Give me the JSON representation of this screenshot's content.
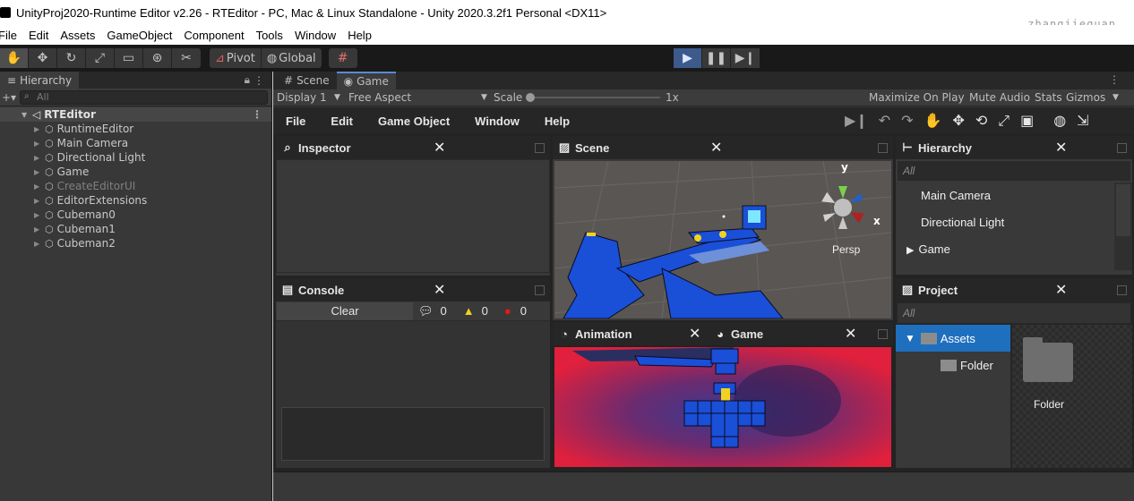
{
  "window": {
    "title": "UnityProj2020-Runtime Editor v2.26 - RTEditor - PC, Mac & Linux Standalone - Unity 2020.3.2f1 Personal <DX11>",
    "watermark": "zhangjiequan"
  },
  "menubar": [
    "File",
    "Edit",
    "Assets",
    "GameObject",
    "Component",
    "Tools",
    "Window",
    "Help"
  ],
  "toolbar": {
    "pivot": "Pivot",
    "global": "Global"
  },
  "hierarchy": {
    "tab": "Hierarchy",
    "search_placeholder": "All",
    "root": "RTEditor",
    "items": [
      {
        "label": "RuntimeEditor",
        "dim": false
      },
      {
        "label": "Main Camera",
        "dim": false
      },
      {
        "label": "Directional Light",
        "dim": false
      },
      {
        "label": "Game",
        "dim": false
      },
      {
        "label": "CreateEditorUI",
        "dim": true
      },
      {
        "label": "EditorExtensions",
        "dim": false
      },
      {
        "label": "Cubeman0",
        "dim": false
      },
      {
        "label": "Cubeman1",
        "dim": false
      },
      {
        "label": "Cubeman2",
        "dim": false
      }
    ]
  },
  "tabs": {
    "scene": "Scene",
    "game": "Game"
  },
  "game_toolbar": {
    "display": "Display 1",
    "aspect": "Free Aspect",
    "scale_label": "Scale",
    "scale_value": "1x",
    "maximize": "Maximize On Play",
    "mute": "Mute Audio",
    "stats": "Stats",
    "gizmos": "Gizmos"
  },
  "rt": {
    "menu": [
      "File",
      "Edit",
      "Game Object",
      "Window",
      "Help"
    ],
    "inspector": "Inspector",
    "console": {
      "title": "Console",
      "clear": "Clear",
      "info_count": "0",
      "warn_count": "0",
      "error_count": "0"
    },
    "scene": {
      "title": "Scene",
      "persp": "Persp",
      "axis_y": "y",
      "axis_x": "x"
    },
    "animation": "Animation",
    "game": "Game",
    "hierarchy": {
      "title": "Hierarchy",
      "search": "All",
      "items": [
        "Main Camera",
        "Directional Light",
        "Game"
      ]
    },
    "project": {
      "title": "Project",
      "search": "All",
      "assets": "Assets",
      "folder": "Folder",
      "folder_tile": "Folder"
    }
  },
  "colors": {
    "accent": "#5a8ad6",
    "selection": "#1f6fbf",
    "cube_blue": "#1a4fd8",
    "game_red": "#e0203c"
  }
}
